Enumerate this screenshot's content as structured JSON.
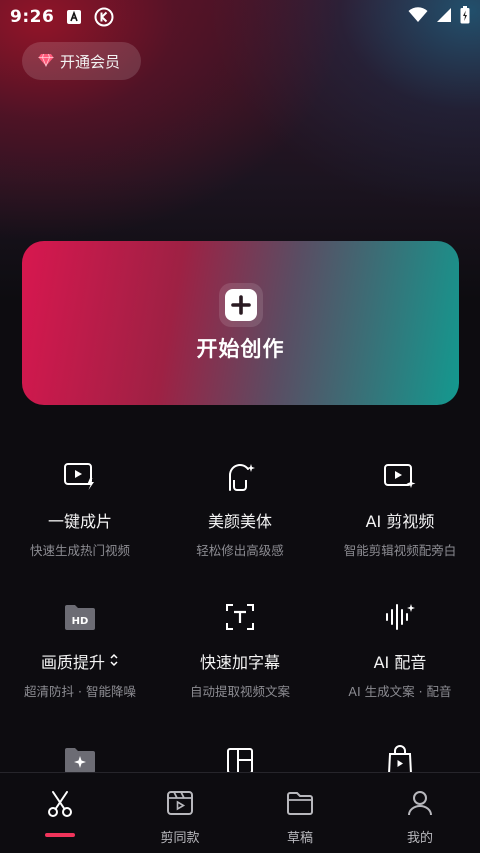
{
  "status_bar": {
    "time": "9:26"
  },
  "vip": {
    "label": "开通会员"
  },
  "create": {
    "label": "开始创作"
  },
  "tools": [
    {
      "title": "一键成片",
      "subtitle": "快速生成热门视频",
      "icon": "play-spark-icon"
    },
    {
      "title": "美颜美体",
      "subtitle": "轻松修出高级感",
      "icon": "face-beauty-icon"
    },
    {
      "title": "AI 剪视频",
      "subtitle": "智能剪辑视频配旁白",
      "icon": "ai-clip-icon"
    },
    {
      "title": "画质提升",
      "subtitle": "超清防抖 · 智能降噪",
      "icon": "hd-icon",
      "has_dropdown": true
    },
    {
      "title": "快速加字幕",
      "subtitle": "自动提取视频文案",
      "icon": "text-frame-icon"
    },
    {
      "title": "AI 配音",
      "subtitle": "AI 生成文案 · 配音",
      "icon": "voice-wave-icon"
    }
  ],
  "tabs": [
    {
      "label": "",
      "icon": "scissors-icon",
      "active": true
    },
    {
      "label": "剪同款",
      "icon": "template-icon"
    },
    {
      "label": "草稿",
      "icon": "folder-icon"
    },
    {
      "label": "我的",
      "icon": "profile-icon"
    }
  ],
  "colors": {
    "accent": "#f0345b",
    "card_start": "#d8174f",
    "card_end": "#13998f"
  }
}
